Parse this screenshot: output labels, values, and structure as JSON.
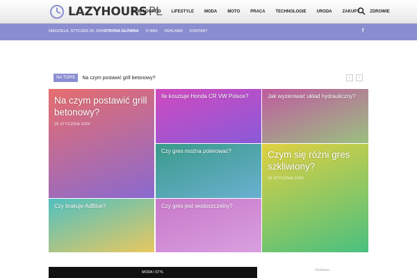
{
  "header": {
    "logo_text": "LAZYHOURS",
    "logo_tld": "PL",
    "nav": [
      "DOM I OGRÓD",
      "LIFESTYLE",
      "MODA",
      "MOTO",
      "PRACA",
      "TECHNOLOGIE",
      "URODA",
      "ZAKUPY",
      "ZDROWIE"
    ]
  },
  "subbar": {
    "date": "NIEDZIELA, STYCZEŃ 28, 2024",
    "links": [
      "STRONA GŁÓWNA",
      "O NAS",
      "REKLAMA",
      "KONTAKT"
    ],
    "facebook": "f"
  },
  "ticker": {
    "tag": "NA TOPIE",
    "headline": "Na czym postawić grill betonowy?",
    "prev": "‹",
    "next": "›"
  },
  "tiles": [
    {
      "title": "Na czym postawić grill betonowy?",
      "date": "28 STYCZNIA 2024",
      "gradient": [
        "#e86d6d",
        "#8a6ad0"
      ]
    },
    {
      "title": "Ile kosztuje Honda CR VW Polsce?",
      "gradient": [
        "#d04ac0",
        "#8a5ad8"
      ]
    },
    {
      "title": "Jak wyzerować układ hydrauliczny?",
      "gradient": [
        "#c05aa0",
        "#9ac080"
      ]
    },
    {
      "title": "Czy gres można polerować?",
      "gradient": [
        "#3a9a8a",
        "#6ab0d0"
      ]
    },
    {
      "title": "Czym się różni gres szkliwiony?",
      "date": "28 STYCZNIA 2024",
      "gradient": [
        "#e0d040",
        "#4ac080"
      ]
    },
    {
      "title": "Czy brakuje AdBlue?",
      "gradient": [
        "#50c0c0",
        "#e8c860"
      ]
    },
    {
      "title": "Czy gres jest wodoszczelny?",
      "gradient": [
        "#c878c8",
        "#d8a0e0"
      ]
    }
  ],
  "bottom": {
    "section_label": "MODA I STYL",
    "ad_label": "- Reklama -"
  }
}
